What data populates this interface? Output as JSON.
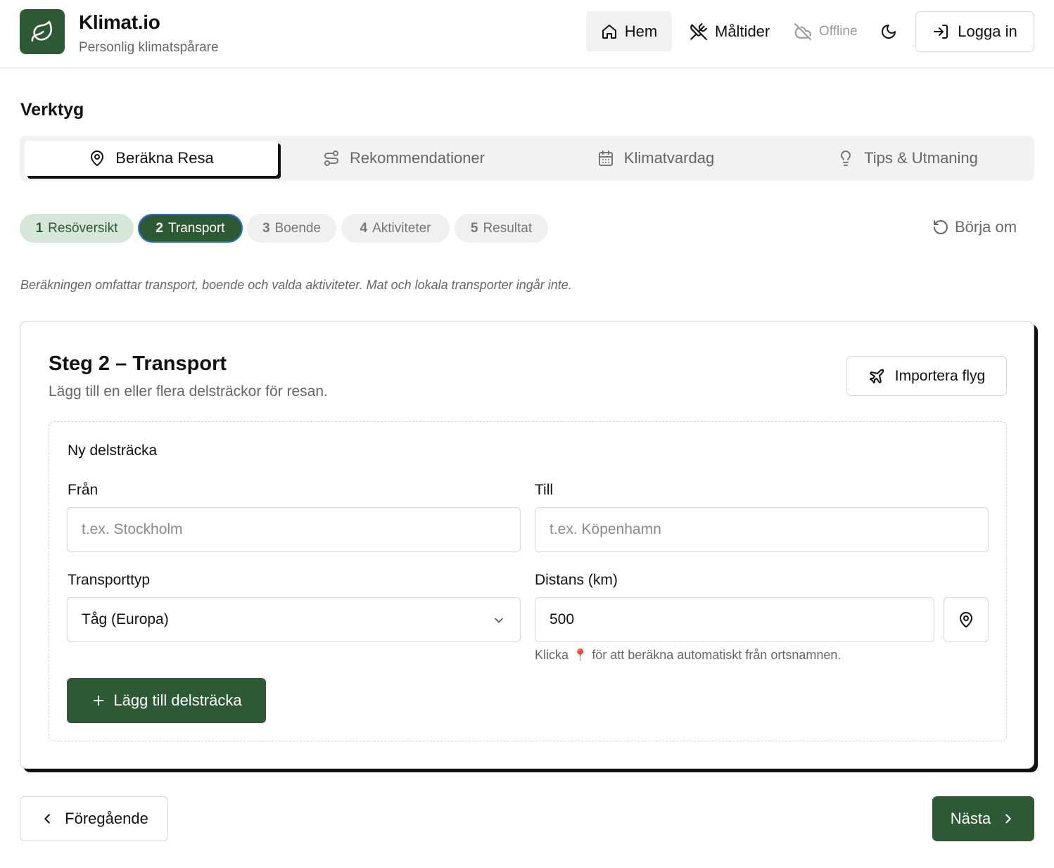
{
  "app": {
    "title": "Klimat.io",
    "subtitle": "Personlig klimatspårare",
    "brand_color": "#2d5a35"
  },
  "nav": {
    "home": "Hem",
    "meals": "Måltider",
    "offline": "Offline",
    "login": "Logga in"
  },
  "tools": {
    "title": "Verktyg",
    "tabs": [
      {
        "label": "Beräkna Resa",
        "icon": "map-pin-icon",
        "active": true
      },
      {
        "label": "Rekommendationer",
        "icon": "route-icon",
        "active": false
      },
      {
        "label": "Klimatvardag",
        "icon": "calendar-icon",
        "active": false
      },
      {
        "label": "Tips & Utmaning",
        "icon": "lightbulb-icon",
        "active": false
      }
    ]
  },
  "steps": [
    {
      "num": "1",
      "label": "Resöversikt",
      "state": "done"
    },
    {
      "num": "2",
      "label": "Transport",
      "state": "current"
    },
    {
      "num": "3",
      "label": "Boende",
      "state": "pending"
    },
    {
      "num": "4",
      "label": "Aktiviteter",
      "state": "pending"
    },
    {
      "num": "5",
      "label": "Resultat",
      "state": "pending"
    }
  ],
  "restart": "Börja om",
  "note": "Beräkningen omfattar transport, boende och valda aktiviteter. Mat och lokala transporter ingår inte.",
  "card": {
    "title": "Steg 2 – Transport",
    "subtitle": "Lägg till en eller flera delsträckor för resan.",
    "import_button": "Importera flyg",
    "leg": {
      "title": "Ny delsträcka",
      "from_label": "Från",
      "from_placeholder": "t.ex. Stockholm",
      "to_label": "Till",
      "to_placeholder": "t.ex. Köpenhamn",
      "transport_label": "Transporttyp",
      "transport_value": "Tåg (Europa)",
      "distance_label": "Distans (km)",
      "distance_value": "500",
      "hint_before": "Klicka",
      "hint_after": "för att beräkna automatiskt från ortsnamnen.",
      "add_button": "Lägg till delsträcka"
    }
  },
  "footer": {
    "prev": "Föregående",
    "next": "Nästa"
  }
}
